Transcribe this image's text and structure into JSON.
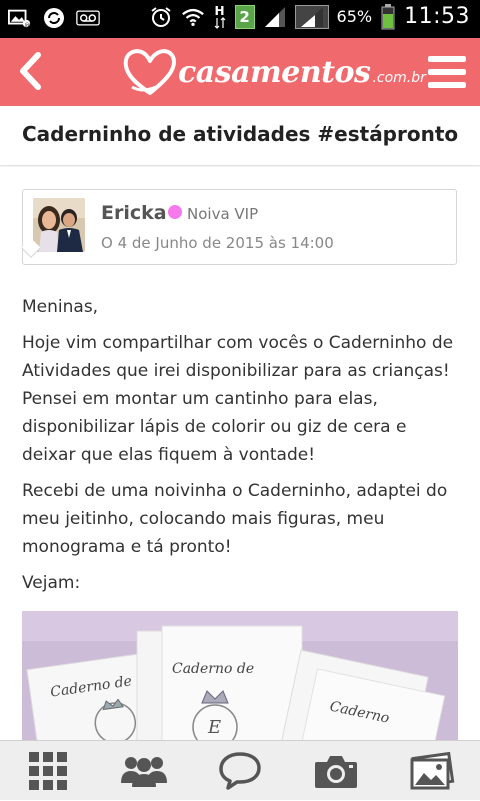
{
  "status_bar": {
    "battery_percent": "65%",
    "time": "11:53",
    "notification_badge": "2",
    "network_badge": "H",
    "icons_left": [
      "gallery-notification-icon",
      "sync-icon",
      "voicemail-icon"
    ],
    "icons_right": [
      "alarm-icon",
      "wifi-icon",
      "mobile-data-icon",
      "signal-icon",
      "signal-icon-2",
      "battery-icon"
    ]
  },
  "app_bar": {
    "brand_name": "casamentos",
    "brand_tld": ".com.br",
    "brand_color": "#f06a6d"
  },
  "page": {
    "title": "Caderninho de atividades #estápronto"
  },
  "author": {
    "name": "Ericka",
    "badge": "Noiva VIP",
    "badge_color": "#f779ee",
    "date": "O 4 de Junho de 2015 às 14:00"
  },
  "post": {
    "paragraphs": [
      "Meninas,",
      "Hoje vim compartilhar com vocês o Caderninho de Atividades que irei disponibilizar para as crianças! Pensei em montar um cantinho para elas, disponibilizar lápis de colorir ou giz de cera e deixar que elas fiquem à vontade!",
      "Recebi de uma noivinha o Caderninho, adaptei do meu jeitinho, colocando mais figuras, meu monograma e tá pronto!",
      "Vejam:"
    ],
    "photo_text": [
      "Caderno de",
      "Caderno de",
      "Caderno"
    ]
  },
  "bottom_nav": [
    "grid-icon",
    "community-icon",
    "chat-icon",
    "camera-icon",
    "photos-icon"
  ]
}
